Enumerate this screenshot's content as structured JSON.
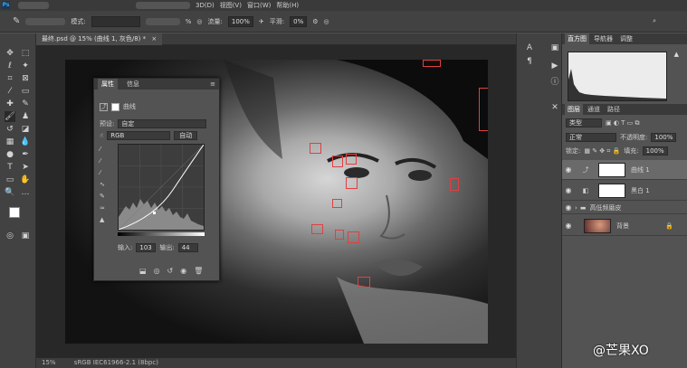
{
  "menubar": {
    "items": [
      "3D(D)",
      "视图(V)",
      "窗口(W)",
      "帮助(H)"
    ]
  },
  "options": {
    "mode_label": "模式:",
    "opacity_pct": "%",
    "flow_label": "流量:",
    "flow_value": "100%",
    "smooth_label": "平滑:",
    "smooth_value": "0%"
  },
  "document": {
    "tab_title": "最终.psd @ 15% (曲线 1, 灰色/8) *"
  },
  "status": {
    "zoom": "15%",
    "profile": "sRGB IEC61966-2.1 (8bpc)"
  },
  "properties": {
    "tabs": [
      "属性",
      "信息"
    ],
    "title": "曲线",
    "preset_label": "预设:",
    "preset_value": "自定",
    "channel": "RGB",
    "auto_button": "自动",
    "input_label": "输入:",
    "input_value": "103",
    "output_label": "输出:",
    "output_value": "44"
  },
  "histogram_panel": {
    "tabs": [
      "直方图",
      "导航器",
      "调整"
    ]
  },
  "layers_panel": {
    "tabs": [
      "图层",
      "通道",
      "路径"
    ],
    "kind": "类型",
    "blend_mode": "正常",
    "opacity_label": "不透明度:",
    "opacity_value": "100%",
    "lock_label": "锁定:",
    "fill_label": "填充:",
    "fill_value": "100%",
    "layers": [
      {
        "name": "曲线 1"
      },
      {
        "name": "黑白 1"
      },
      {
        "name": "高低频磨皮"
      },
      {
        "name": "背景"
      }
    ]
  },
  "watermark": "@芒果XO",
  "colors": {
    "accent_red": "#e04040",
    "panel": "#535353",
    "dark": "#282828"
  }
}
